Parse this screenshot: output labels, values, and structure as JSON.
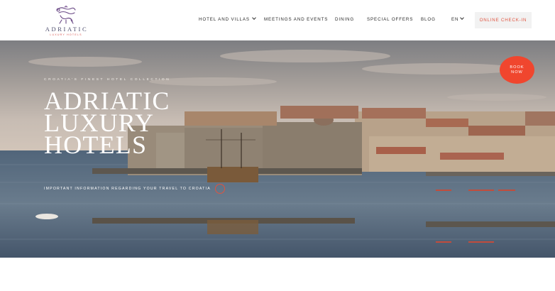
{
  "brand": {
    "name": "ADRIATIC",
    "sub": "LUXURY HOTELS"
  },
  "nav": {
    "items": [
      {
        "label": "HOTEL AND VILLAS",
        "dropdown": true
      },
      {
        "label": "MEETINGS AND EVENTS",
        "dropdown": false
      },
      {
        "label": "DINING",
        "dropdown": false
      },
      {
        "label": "SPECIAL OFFERS",
        "dropdown": false
      },
      {
        "label": "BLOG",
        "dropdown": false
      }
    ],
    "language": "EN",
    "checkin_label": "ONLINE CHECK-IN"
  },
  "hero": {
    "tagline": "CROATIA'S FINEST HOTEL COLLECTION",
    "headline": [
      "ADRIATIC",
      "LUXURY",
      "HOTELS"
    ],
    "info_link": "IMPORTANT INFORMATION REGARDING YOUR TRAVEL TO CROATIA",
    "book_now": [
      "BOOK",
      "NOW"
    ]
  },
  "colors": {
    "accent": "#f0462e",
    "checkin_text": "#e0533f",
    "logo_purple": "#4a4a6a"
  }
}
